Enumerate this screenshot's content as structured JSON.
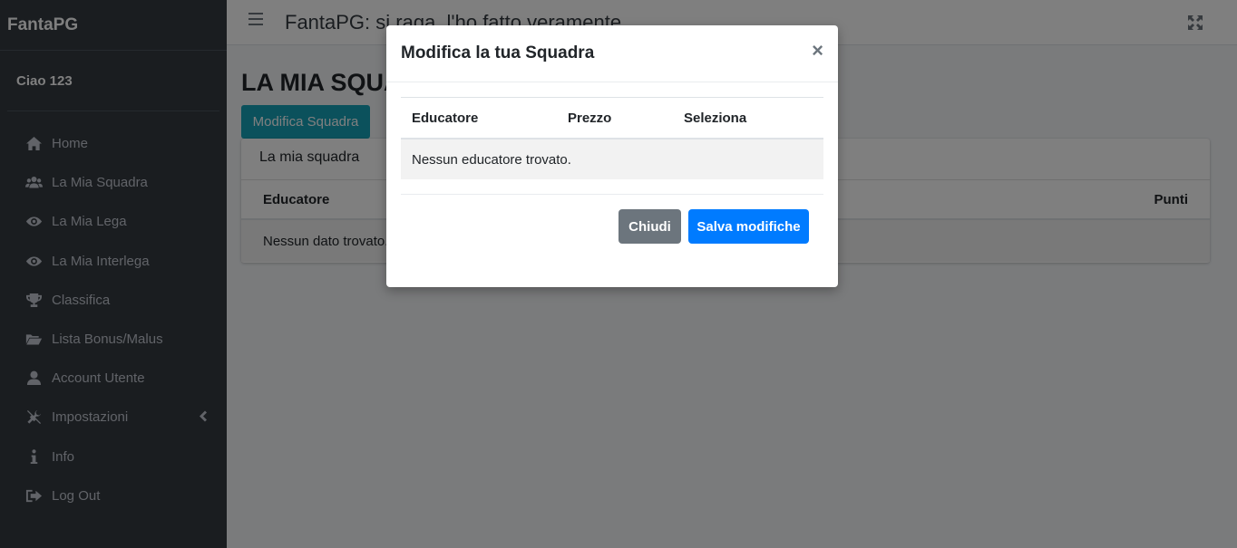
{
  "sidebar": {
    "brand": "FantaPG",
    "user": "Ciao 123",
    "items": [
      {
        "label": "Home",
        "icon": "home-icon"
      },
      {
        "label": "La Mia Squadra",
        "icon": "users-icon"
      },
      {
        "label": "La Mia Lega",
        "icon": "eye-icon"
      },
      {
        "label": "La Mia Interlega",
        "icon": "eye-icon"
      },
      {
        "label": "Classifica",
        "icon": "trophy-icon"
      },
      {
        "label": "Lista Bonus/Malus",
        "icon": "folder-open-icon"
      },
      {
        "label": "Account Utente",
        "icon": "user-icon"
      },
      {
        "label": "Impostazioni",
        "icon": "tools-icon"
      },
      {
        "label": "Info",
        "icon": "info-icon"
      },
      {
        "label": "Log Out",
        "icon": "sign-out-icon"
      }
    ]
  },
  "topbar": {
    "title": "FantaPG: si raga, l'ho fatto veramente"
  },
  "main": {
    "page_title": "LA MIA SQUADRA",
    "edit_button": "Modifica Squadra",
    "card": {
      "header": "La mia squadra",
      "columns": [
        "Educatore",
        "Punti"
      ],
      "empty_text": "Nessun dato trovato."
    }
  },
  "modal": {
    "title": "Modifica la tua Squadra",
    "close_symbol": "×",
    "columns": [
      "Educatore",
      "Prezzo",
      "Seleziona"
    ],
    "empty_text": "Nessun educatore trovato.",
    "close_button": "Chiudi",
    "save_button": "Salva modifiche"
  },
  "colors": {
    "sidebar_bg": "#343a40",
    "accent_info": "#17a2b8",
    "primary": "#007bff",
    "secondary": "#6c757d"
  }
}
